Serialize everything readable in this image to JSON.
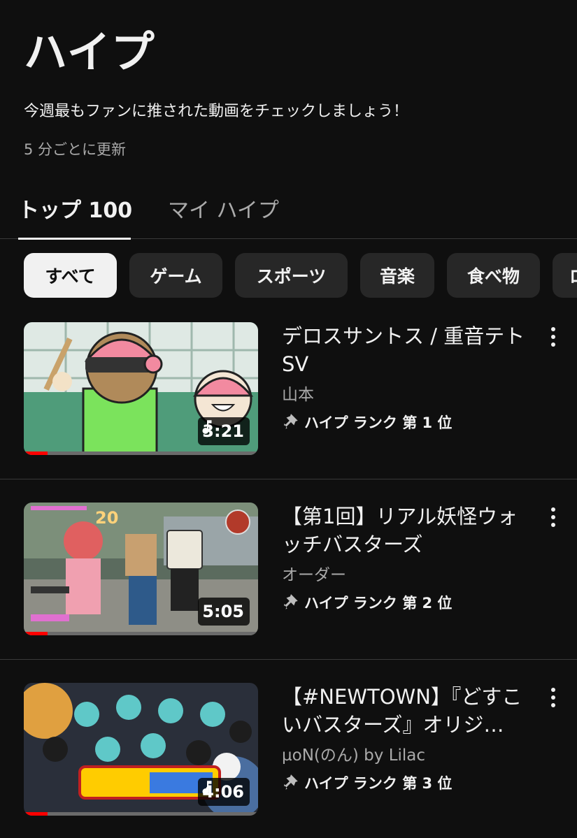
{
  "header": {
    "title": "ハイプ",
    "description": "今週最もファンに推された動画をチェックしましょう！",
    "update_note": "5 分ごとに更新"
  },
  "tabs": [
    {
      "label": "トップ 100",
      "active": true
    },
    {
      "label": "マイ ハイプ",
      "active": false
    }
  ],
  "chips": [
    {
      "label": "すべて",
      "selected": true
    },
    {
      "label": "ゲーム",
      "selected": false
    },
    {
      "label": "スポーツ",
      "selected": false
    },
    {
      "label": "音楽",
      "selected": false
    },
    {
      "label": "食べ物",
      "selected": false
    },
    {
      "label": "ロ",
      "selected": false
    }
  ],
  "videos": [
    {
      "title": "デロスサントス / 重音テトSV",
      "channel": "山本",
      "rank": "ハイプ ランク 第 1 位",
      "duration": "3:21",
      "is_music": true,
      "watch_progress": 0.1
    },
    {
      "title": "【第1回】リアル妖怪ウォッチバスターズ",
      "channel": "オーダー",
      "rank": "ハイプ ランク 第 2 位",
      "duration": "5:05",
      "is_music": false,
      "watch_progress": 0.1
    },
    {
      "title": "【#NEWTOWN】『どすこいバスターズ』オリジ…",
      "channel": "µoN(のん) by Lilac",
      "rank": "ハイプ ランク 第 3 位",
      "duration": "4:06",
      "is_music": true,
      "watch_progress": 0.1
    }
  ],
  "colors": {
    "background": "#0f0f0f",
    "chip": "#272727",
    "chip_selected": "#f1f1f1",
    "text_secondary": "#aaaaaa",
    "progress": "#ff0000"
  },
  "icons": {
    "music": "music-note-icon",
    "hype": "hype-megaphone-icon",
    "more": "more-vert-icon"
  }
}
